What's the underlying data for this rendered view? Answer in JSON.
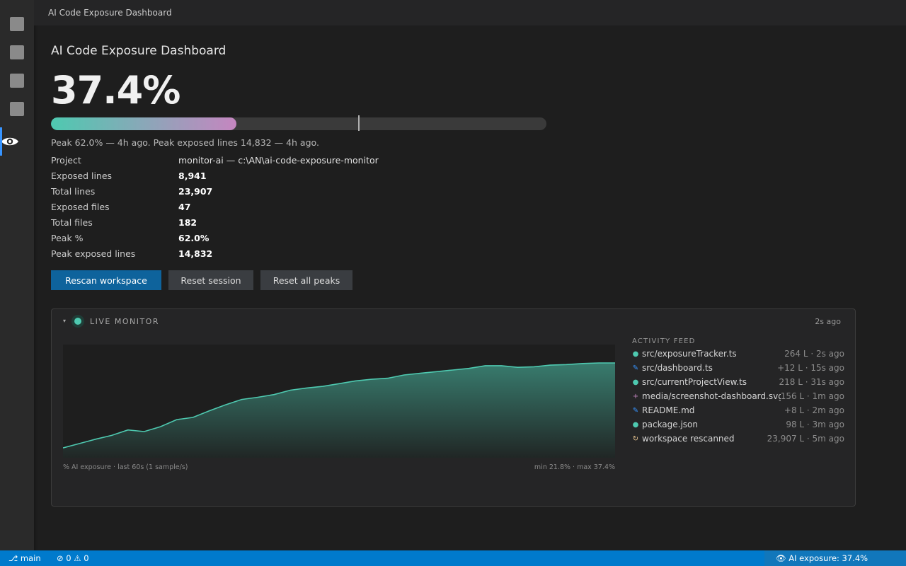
{
  "window": {
    "title": "AI Code Exposure Dashboard"
  },
  "activity_bar": {
    "active_icon": "eye-icon"
  },
  "dashboard": {
    "title": "AI Code Exposure Dashboard",
    "exposure_pct_label": "37.4%",
    "exposure_fraction": 0.374,
    "peak_fraction": 0.62,
    "peak_note": "Peak 62.0% — 4h ago. Peak exposed lines 14,832 — 4h ago.",
    "stats": [
      {
        "label": "Project",
        "value": "monitor-ai — c:\\AN\\ai-code-exposure-monitor"
      },
      {
        "label": "Exposed lines",
        "value": "8,941"
      },
      {
        "label": "Total lines",
        "value": "23,907"
      },
      {
        "label": "Exposed files",
        "value": "47"
      },
      {
        "label": "Total files",
        "value": "182"
      },
      {
        "label": "Peak %",
        "value": "62.0%"
      },
      {
        "label": "Peak exposed lines",
        "value": "14,832"
      }
    ],
    "buttons": {
      "rescan": "Rescan workspace",
      "reset_session": "Reset session",
      "reset_peaks": "Reset all peaks"
    }
  },
  "monitor": {
    "caret": "▾",
    "title": "LIVE MONITOR",
    "updated": "2s ago",
    "caption_left": "% AI exposure · last 60s (1 sample/s)",
    "caption_right": "min 21.8% · max 37.4%",
    "feed_title": "ACTIVITY FEED",
    "feed": [
      {
        "icon": "●",
        "color": "#4ec9b0",
        "name": "src/exposureTracker.ts",
        "meta": "264 L · 2s ago"
      },
      {
        "icon": "✎",
        "color": "#3794ff",
        "name": "src/dashboard.ts",
        "meta": "+12 L · 15s ago"
      },
      {
        "icon": "●",
        "color": "#4ec9b0",
        "name": "src/currentProjectView.ts",
        "meta": "218 L · 31s ago"
      },
      {
        "icon": "+",
        "color": "#c586c0",
        "name": "media/screenshot-dashboard.svg",
        "meta": "156 L · 1m ago"
      },
      {
        "icon": "✎",
        "color": "#3794ff",
        "name": "README.md",
        "meta": "+8 L · 2m ago"
      },
      {
        "icon": "●",
        "color": "#4ec9b0",
        "name": "package.json",
        "meta": "98 L · 3m ago"
      },
      {
        "icon": "↻",
        "color": "#e2c08d",
        "name": "workspace rescanned",
        "meta": "23,907 L · 5m ago"
      }
    ]
  },
  "chart_data": {
    "type": "area",
    "ylim": [
      20,
      40
    ],
    "color": "#4ec9b0",
    "x": [
      0,
      2,
      4,
      6,
      8,
      10,
      12,
      14,
      16,
      18,
      20,
      22,
      24,
      26,
      28,
      30,
      32,
      34,
      36,
      38,
      40,
      42,
      44,
      46,
      48,
      50,
      52,
      54,
      56,
      58,
      60
    ],
    "values": [
      21.8,
      22.6,
      23.4,
      24.1,
      25.1,
      24.8,
      25.7,
      27.0,
      27.4,
      28.6,
      29.7,
      30.7,
      31.1,
      31.6,
      32.4,
      32.8,
      33.1,
      33.6,
      34.1,
      34.4,
      34.6,
      35.2,
      35.5,
      35.8,
      36.1,
      36.4,
      36.9,
      36.9,
      36.6,
      36.7,
      37.0,
      37.1,
      37.3,
      37.4,
      37.4
    ]
  },
  "statusbar": {
    "branch": "⎇ main",
    "problems": "⊘ 0 ⚠ 0",
    "exposure": "👁 AI exposure: 37.4%"
  },
  "colors": {
    "accent": "#007acc",
    "primary_button": "#0e639c",
    "progress_start": "#4ec9b0",
    "progress_end": "#c586c0"
  }
}
